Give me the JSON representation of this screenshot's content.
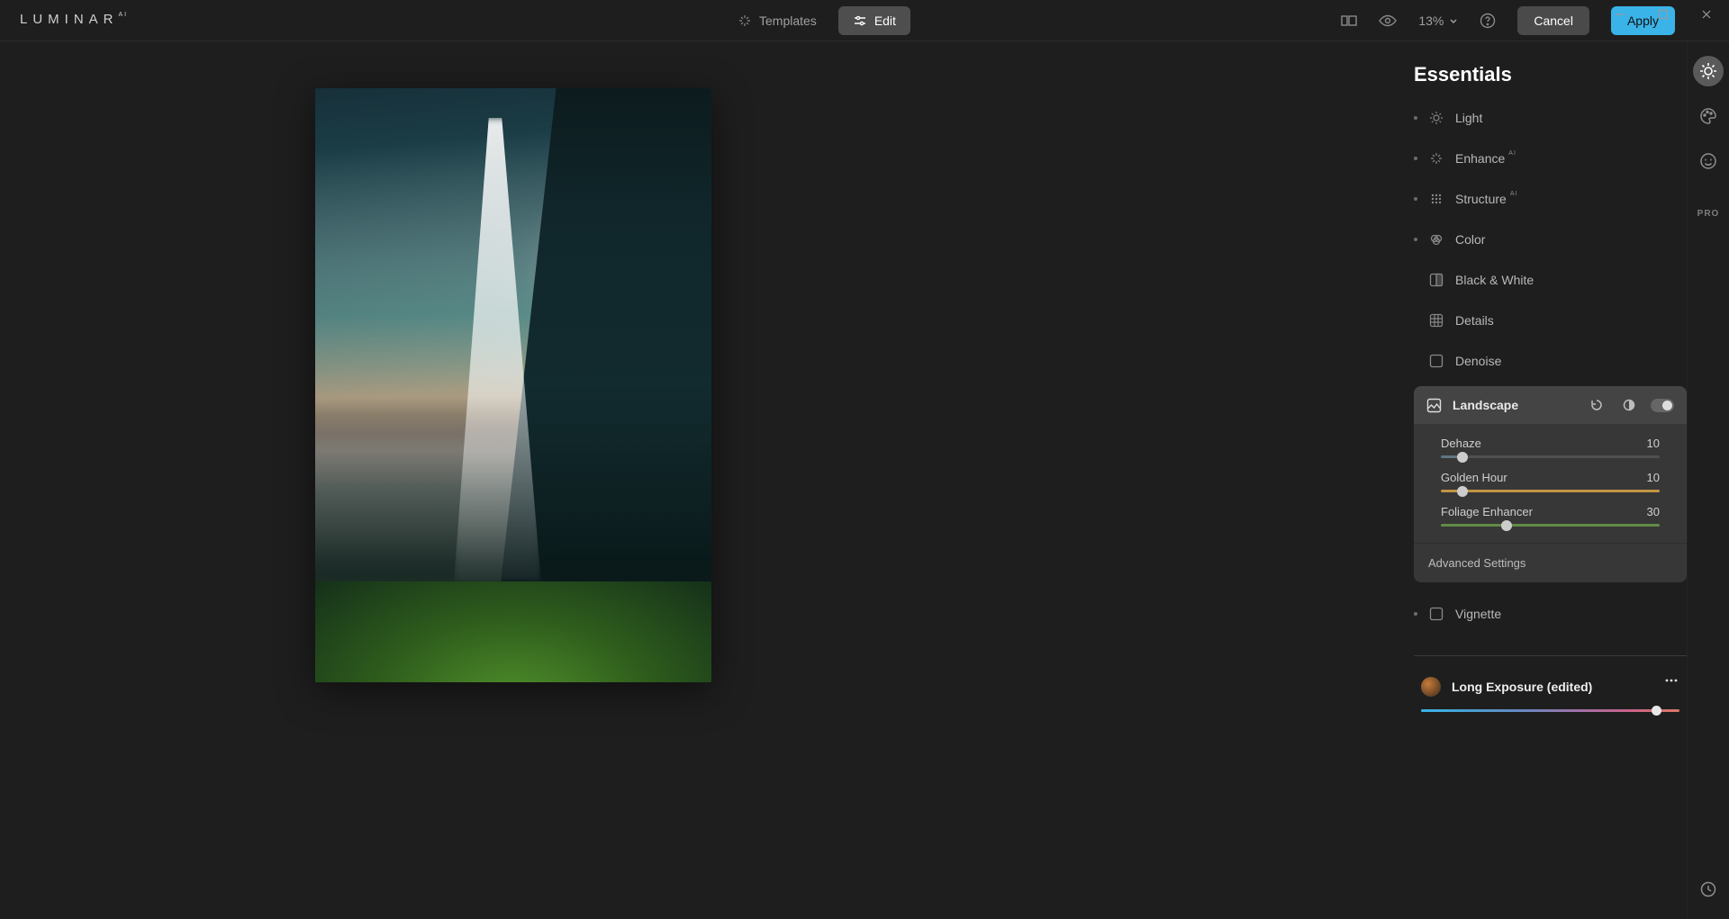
{
  "app": {
    "name": "LUMINAR",
    "edition": "AI"
  },
  "topbar": {
    "templates": "Templates",
    "edit": "Edit",
    "zoom": "13%",
    "cancel": "Cancel",
    "apply": "Apply"
  },
  "panel": {
    "title": "Essentials",
    "tools": [
      {
        "key": "light",
        "label": "Light",
        "icon": "light-icon",
        "dot": true,
        "ai": false
      },
      {
        "key": "enhance",
        "label": "Enhance",
        "icon": "enhance-icon",
        "dot": true,
        "ai": true
      },
      {
        "key": "structure",
        "label": "Structure",
        "icon": "structure-icon",
        "dot": true,
        "ai": true
      },
      {
        "key": "color",
        "label": "Color",
        "icon": "color-icon",
        "dot": true,
        "ai": false
      },
      {
        "key": "bw",
        "label": "Black & White",
        "icon": "bw-icon",
        "dot": false,
        "ai": false
      },
      {
        "key": "details",
        "label": "Details",
        "icon": "details-icon",
        "dot": false,
        "ai": false
      },
      {
        "key": "denoise",
        "label": "Denoise",
        "icon": "denoise-icon",
        "dot": false,
        "ai": false
      }
    ],
    "landscape": {
      "label": "Landscape",
      "advanced": "Advanced Settings",
      "sliders": [
        {
          "key": "dehaze",
          "label": "Dehaze",
          "value": 10,
          "max": 100,
          "color_left": "#69808f",
          "color_right": "#555"
        },
        {
          "key": "golden",
          "label": "Golden Hour",
          "value": 10,
          "max": 100,
          "color_left": "#d9a646",
          "color_right": "#d9a646"
        },
        {
          "key": "foliage",
          "label": "Foliage Enhancer",
          "value": 30,
          "max": 100,
          "color_left": "#6a9a4a",
          "color_right": "#6a9a4a"
        }
      ]
    },
    "vignette": {
      "label": "Vignette"
    },
    "preset": {
      "name": "Long Exposure (edited)"
    }
  },
  "sidebar": {
    "items": [
      {
        "key": "essentials",
        "icon": "sun-icon",
        "active": true
      },
      {
        "key": "creative",
        "icon": "palette-icon",
        "active": false
      },
      {
        "key": "portrait",
        "icon": "face-icon",
        "active": false
      }
    ],
    "pro": "PRO"
  }
}
